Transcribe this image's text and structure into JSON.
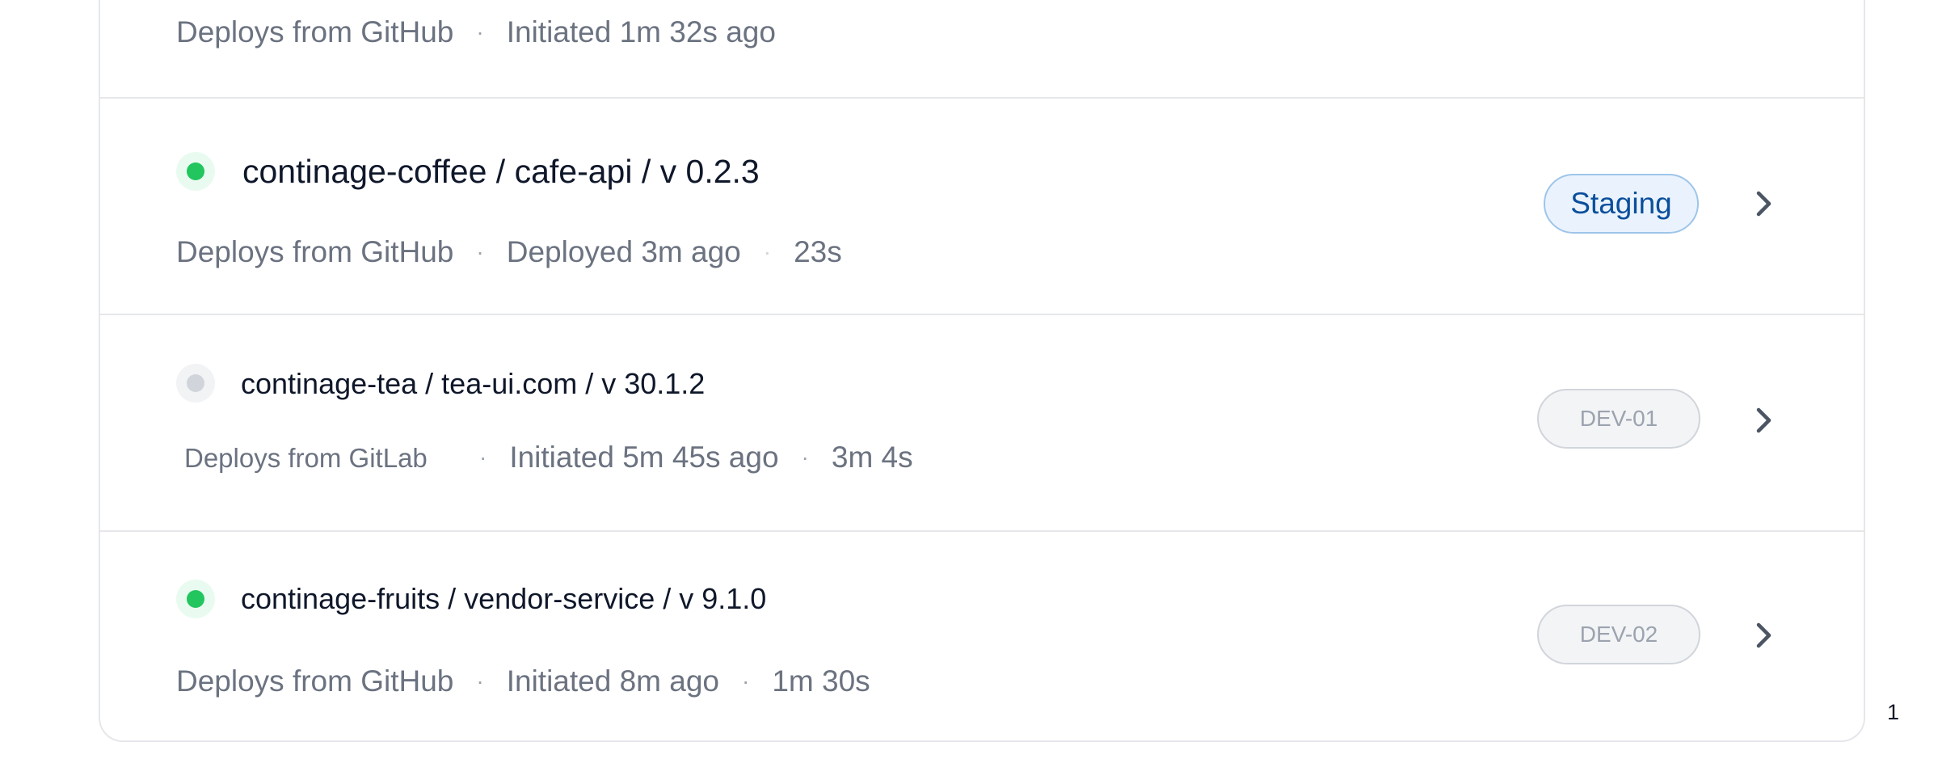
{
  "deployments": [
    {
      "title": "",
      "source": "Deploys from GitHub",
      "status_text": "Initiated 1m 32s ago",
      "duration": "",
      "environment": "",
      "active": null
    },
    {
      "title": "continage-coffee / cafe-api / v 0.2.3",
      "source": "Deploys from GitHub",
      "status_text": "Deployed 3m ago",
      "duration": "23s",
      "environment": "Staging",
      "active": true
    },
    {
      "title": "continage-tea / tea-ui.com / v 30.1.2",
      "source": "Deploys from GitLab",
      "status_text": "Initiated 5m 45s ago",
      "duration": "3m 4s",
      "environment": "DEV-01",
      "active": false
    },
    {
      "title": "continage-fruits / vendor-service / v 9.1.0",
      "source": "Deploys from GitHub",
      "status_text": "Initiated 8m ago",
      "duration": "1m 30s",
      "environment": "DEV-02",
      "active": true
    }
  ],
  "separator": "·",
  "page_number": "1",
  "colors": {
    "active_dot": "#22c55e",
    "inactive_dot": "#d1d5db",
    "staging_text": "#0b4f9c",
    "staging_bg": "#eaf3fd",
    "dev_text": "#9ca3af",
    "meta_text": "#6b7280"
  },
  "icons": {
    "status": "status-dot-icon",
    "open": "chevron-right-icon"
  }
}
